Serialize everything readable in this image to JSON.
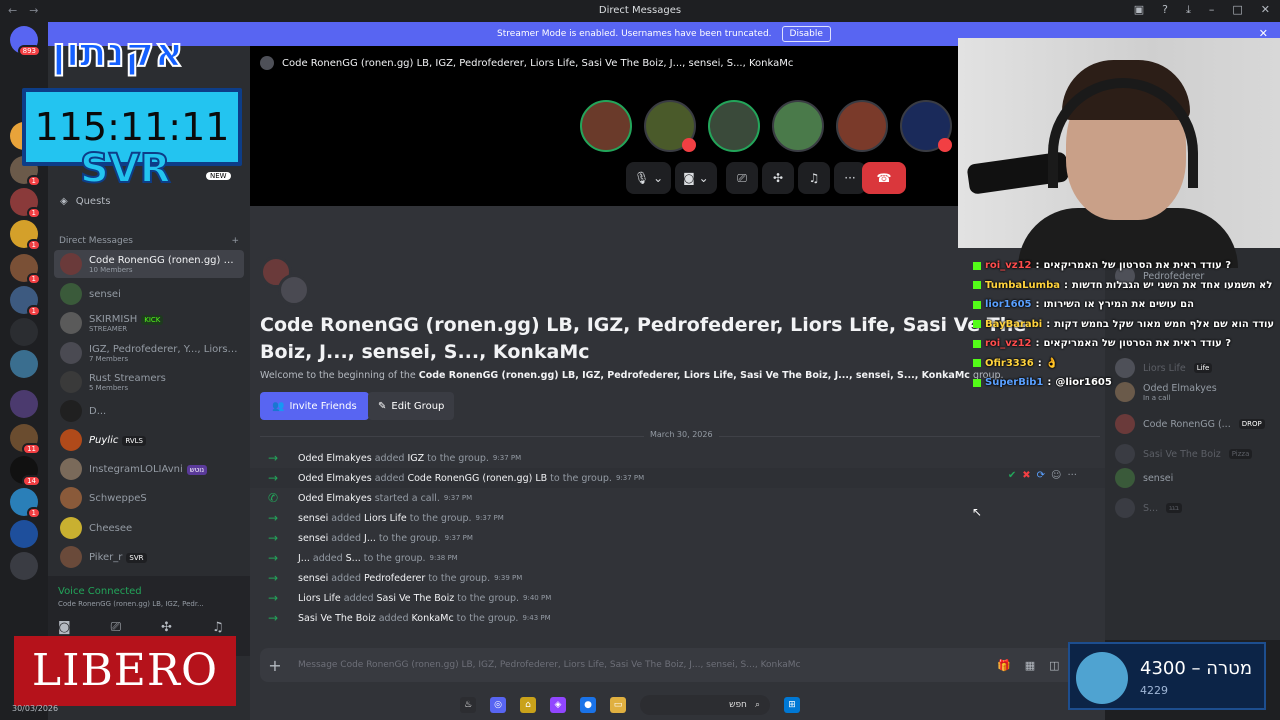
{
  "window": {
    "title": "Direct Messages",
    "nav_back": "←",
    "nav_forward": "→"
  },
  "banner": {
    "text": "Streamer Mode is enabled. Usernames have been truncated.",
    "disable_label": "Disable",
    "close": "✕"
  },
  "overlay": {
    "timer": "115:11:11",
    "svr": "SVR",
    "new_badge": "NEW",
    "libero": "LIBERO",
    "date": "30/03/2026"
  },
  "servers": {
    "badges": [
      "893",
      "1",
      "1",
      "1",
      "1",
      "1",
      "11",
      "14",
      "1"
    ]
  },
  "sidebar": {
    "quests_label": "Quests",
    "dm_header": "Direct Messages",
    "dm_add": "+",
    "items": [
      {
        "name": "Code RonenGG (ronen.gg) LB, I...",
        "sub": "10 Members",
        "tag": ""
      },
      {
        "name": "sensei",
        "sub": "",
        "tag": ""
      },
      {
        "name": "SKIRMISH",
        "sub": "STREAMER",
        "tag": "KICK"
      },
      {
        "name": "IGZ, Pedrofederer, Y..., Liors Lif...",
        "sub": "7 Members",
        "tag": ""
      },
      {
        "name": "Rust Streamers",
        "sub": "5 Members",
        "tag": ""
      },
      {
        "name": "D...",
        "sub": "",
        "tag": ""
      },
      {
        "name": "Puylic",
        "sub": "",
        "tag": "RVLS"
      },
      {
        "name": "InstegramLOLIAvni",
        "sub": "",
        "tag": "נוטש"
      },
      {
        "name": "SchweppeS",
        "sub": "",
        "tag": ""
      },
      {
        "name": "Cheesee",
        "sub": "",
        "tag": ""
      },
      {
        "name": "Piker_r",
        "sub": "",
        "tag": "SVR"
      }
    ]
  },
  "voice": {
    "status": "Voice Connected",
    "channel": "Code RonenGG (ronen.gg) LB, IGZ, Pedr..."
  },
  "call": {
    "header": "Code RonenGG (ronen.gg) LB, IGZ, Pedrofederer, Liors Life, Sasi Ve The Boiz, J..., sensei, S..., KonkaMc"
  },
  "channel": {
    "title": "Code RonenGG (ronen.gg) LB, IGZ, Pedrofederer, Liors Life, Sasi Ve The Boiz, J..., sensei, S..., KonkaMc",
    "welcome_prefix": "Welcome to the beginning of the",
    "welcome_name": "Code RonenGG (ronen.gg) LB, IGZ, Pedrofederer, Liors Life, Sasi Ve The Boiz, J..., sensei, S..., KonkaMc",
    "welcome_suffix": "group.",
    "invite_label": "Invite Friends",
    "edit_label": "Edit Group",
    "date_divider": "March 30, 2026"
  },
  "messages": [
    {
      "actor": "Oded Elmakyes",
      "verb": "added",
      "target": "IGZ",
      "rest": "to the group.",
      "time": "9:37 PM",
      "icon": "→"
    },
    {
      "actor": "Oded Elmakyes",
      "verb": "added",
      "target": "Code RonenGG (ronen.gg) LB",
      "rest": "to the group.",
      "time": "9:37 PM",
      "icon": "→"
    },
    {
      "actor": "Oded Elmakyes",
      "verb": "started a call.",
      "target": "",
      "rest": "",
      "time": "9:37 PM",
      "icon": "✆"
    },
    {
      "actor": "sensei",
      "verb": "added",
      "target": "Liors Life",
      "rest": "to the group.",
      "time": "9:37 PM",
      "icon": "→"
    },
    {
      "actor": "sensei",
      "verb": "added",
      "target": "J...",
      "rest": "to the group.",
      "time": "9:37 PM",
      "icon": "→"
    },
    {
      "actor": "J...",
      "verb": "added",
      "target": "S...",
      "rest": "to the group.",
      "time": "9:38 PM",
      "icon": "→"
    },
    {
      "actor": "sensei",
      "verb": "added",
      "target": "Pedrofederer",
      "rest": "to the group.",
      "time": "9:39 PM",
      "icon": "→"
    },
    {
      "actor": "Liors Life",
      "verb": "added",
      "target": "Sasi Ve The Boiz",
      "rest": "to the group.",
      "time": "9:40 PM",
      "icon": "→"
    },
    {
      "actor": "Sasi Ve The Boiz",
      "verb": "added",
      "target": "KonkaMc",
      "rest": "to the group.",
      "time": "9:43 PM",
      "icon": "→"
    }
  ],
  "composer": {
    "placeholder": "Message Code RonenGG (ronen.gg) LB, IGZ, Pedrofederer, Liors Life, Sasi Ve The Boiz, J..., sensei, S..., KonkaMc"
  },
  "members": [
    {
      "name": "Pedrofederer",
      "sub": "",
      "tag": ""
    },
    {
      "name": "Liors Life",
      "sub": "",
      "tag": "Life"
    },
    {
      "name": "Oded Elmakyes",
      "sub": "In a call",
      "tag": ""
    },
    {
      "name": "Code RonenGG (...",
      "sub": "",
      "tag": "DROP"
    },
    {
      "name": "Sasi Ve The Boiz",
      "sub": "",
      "tag": "Pizza"
    },
    {
      "name": "sensei",
      "sub": "",
      "tag": ""
    },
    {
      "name": "S...",
      "sub": "",
      "tag": "בגג"
    }
  ],
  "chat": [
    {
      "user": "roi_vz12",
      "msg": "עודד ראית את הסרטון של האמריקאים ?",
      "color": "#ff4d4d"
    },
    {
      "user": "TumbaLumba",
      "msg": "לא תשמעו אחד את השני יש הגבלות חדשות",
      "color": "#ffd33d"
    },
    {
      "user": "lior1605",
      "msg": "הם עושים את המירץ או השירותו",
      "color": "#5aa0ff"
    },
    {
      "user": "BayBarabi",
      "msg": "עודד הוא שם אלף חמש מאור שקל בחמש דקות",
      "color": "#ffd33d"
    },
    {
      "user": "roi_vz12",
      "msg": "עודד ראית את הסרטון של האמריקאים ?",
      "color": "#ff4d4d"
    },
    {
      "user": "Ofir3336",
      "msg": "👌",
      "color": "#ffd33d"
    },
    {
      "user": "SuperBib1",
      "msg": "@lior1605",
      "color": "#5aa0ff"
    }
  ],
  "goal": {
    "value": "4300",
    "label": "מטרה",
    "sub": "4229"
  },
  "taskbar": {
    "search_label": "חפש"
  }
}
